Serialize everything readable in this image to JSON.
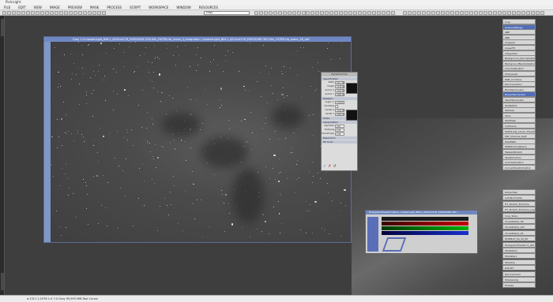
{
  "window": {
    "title": "PixInsight"
  },
  "menu": [
    "FILE",
    "EDIT",
    "VIEW",
    "IMAGE",
    "PREVIEW",
    "MASK",
    "PROCESS",
    "SCRIPT",
    "WORKSPACE",
    "WINDOW",
    "RESOURCES"
  ],
  "toolbar": {
    "combo_value": "Gray"
  },
  "image_window": {
    "title": "Gray 1:4 masterLight_BIN-1_6252x4176_EXPOSURE-300.00s_FILTER-Ha_mono_Ii_integration | masterLight_BIN-1_6252x4176_EXPOSURE-300.00s_FILTER-Ha_mono_18_xisf"
  },
  "dyn_panel": {
    "title": "DynamicCrop",
    "sections": [
      "Specification",
      "Rotation",
      "Scale",
      "Interpolation",
      "Resolution",
      "Fill Color"
    ],
    "rows": [
      {
        "label": "Width",
        "value": "6211.00"
      },
      {
        "label": "Height",
        "value": "4136.00"
      },
      {
        "label": "Anchor X",
        "value": "3126.00"
      },
      {
        "label": "Anchor Y",
        "value": "2088.00"
      },
      {
        "label": "Angle (°)",
        "value": "0.0000"
      },
      {
        "label": "Clockwise",
        "value": ""
      },
      {
        "label": "Center X",
        "value": "3126.00"
      },
      {
        "label": "Center Y",
        "value": "2088.00"
      },
      {
        "label": "Algorithm",
        "value": "Auto"
      },
      {
        "label": "Clamping",
        "value": "0.30"
      },
      {
        "label": "Smoothness",
        "value": "1.50"
      }
    ]
  },
  "histogram": {
    "title": "HistogramTransformation: masterLight_BIN-1_6252x4176_EXPOSURE-300..."
  },
  "process_icons": {
    "top": [
      "Crop",
      "GradientMerge",
      "ABE",
      "DBE",
      "Cropped",
      "LinearFit",
      "Integrated",
      "Background_Normalization",
      "BackgroundNeutralization",
      "ColorCalibration",
      "Sharpened",
      "RGB_Combine",
      "Deconvolution",
      "BlurXTerminator",
      "NoiseXTerminator",
      "StarXTerminator",
      "StarNetV2",
      "Starless",
      "Stars",
      "StarMask",
      "Subframe",
      "MultiScale_Linear_Transform",
      "MLT_Channel_Split",
      "PixelMath",
      "RGBWorkingSpace",
      "MaskedStretch",
      "StarReduction",
      "ColorSaturation",
      "CurvesTransformation"
    ],
    "bottom": [
      "ExtractSat",
      "AutoNormalize",
      "HT_Stretch_Extreme",
      "HT_Stretch_Extreme_Low",
      "Crop_Stars",
      "CloneStamp_HA",
      "CloneStamp_OIII",
      "CloneStamp_SII",
      "HDRMult_Ha_SII_RP",
      "HistogramTransform_OIII",
      "StarReturn",
      "MoreStars",
      "StarOnly",
      "Rebuild",
      "Deconvolved",
      "Sharpening",
      "Finalize"
    ]
  },
  "status": {
    "text": "a:1311   1:1576   1:4   7:0   Gray   95,993 MiB   Tool Cursor"
  }
}
